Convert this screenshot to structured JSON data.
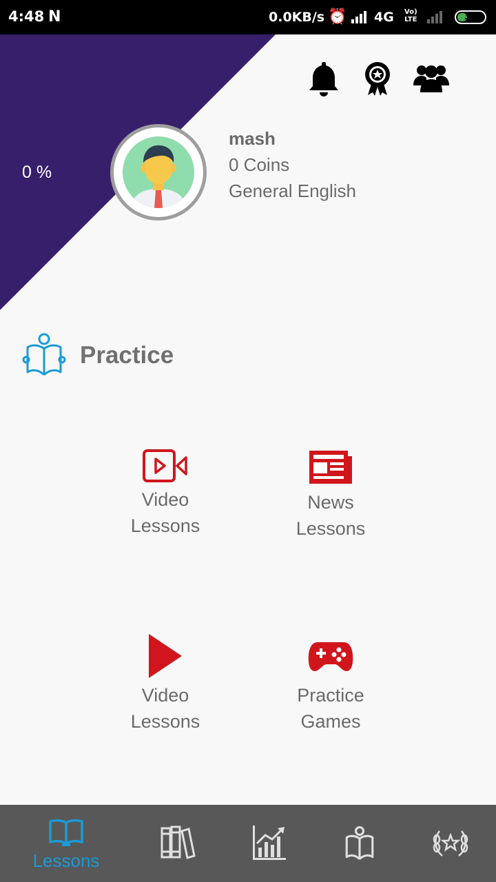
{
  "status_bar": {
    "time": "4:48",
    "network_speed": "0.0KB/s",
    "network_type": "4G",
    "volte_line1": "Vo)",
    "volte_line2": "LTE",
    "battery": "36",
    "battery_level": 0.36
  },
  "profile": {
    "progress": "0 %",
    "name": "mash",
    "coins": "0 Coins",
    "course": "General English"
  },
  "colors": {
    "accent_purple": "#371f6b",
    "lesson_red": "#d0161c",
    "nav_active": "#1b9ad6",
    "nav_background": "#585858"
  },
  "top_icons": [
    "bell-icon",
    "award-ribbon-icon",
    "group-icon"
  ],
  "practice": {
    "title": "Practice",
    "tiles": [
      {
        "line1": "Video",
        "line2": "Lessons",
        "icon": "video-camera-icon"
      },
      {
        "line1": "News",
        "line2": "Lessons",
        "icon": "newspaper-icon"
      },
      {
        "line1": "Video",
        "line2": "Lessons",
        "icon": "play-icon"
      },
      {
        "line1": "Practice",
        "line2": "Games",
        "icon": "gamepad-icon"
      }
    ]
  },
  "bottom_nav": {
    "active_label": "Lessons",
    "items": [
      "book-icon",
      "library-books-icon",
      "chart-icon",
      "reading-icon",
      "laurel-star-icon"
    ]
  }
}
